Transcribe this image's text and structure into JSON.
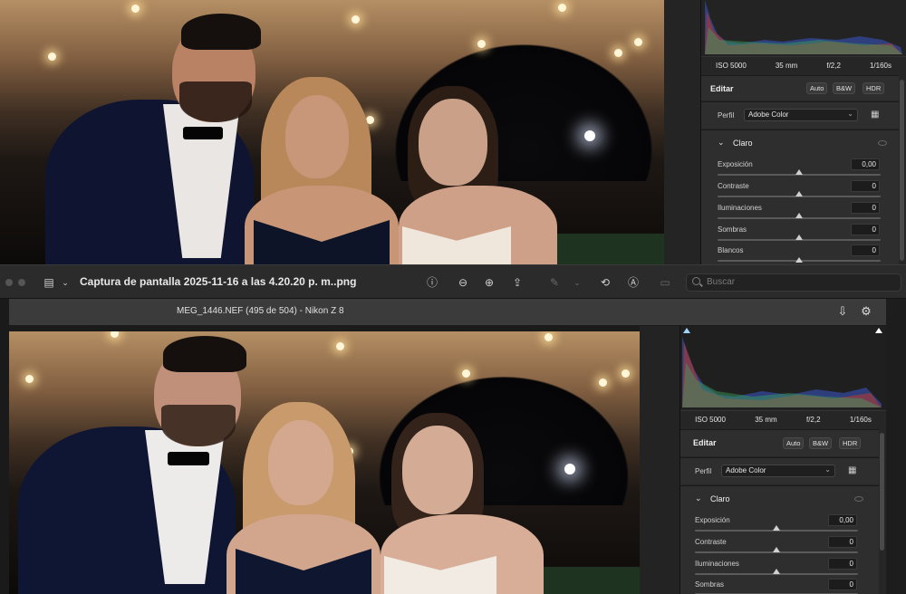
{
  "window": {
    "title": "Captura de pantalla 2025-11-16 a las 4.20.20 p. m..png",
    "search_placeholder": "Buscar"
  },
  "lightroom": {
    "file_info": "MEG_1446.NEF (495 de 504)  -  Nikon Z 8"
  },
  "editor": {
    "meta": {
      "iso": "ISO 5000",
      "focal": "35 mm",
      "aperture": "f/2,2",
      "shutter": "1/160s"
    },
    "edit_label": "Editar",
    "auto_label": "Auto",
    "bw_label": "B&W",
    "hdr_label": "HDR",
    "profile_label": "Perfil",
    "profile_value": "Adobe Color",
    "section_light": "Claro",
    "sliders_top": [
      {
        "label": "Exposición",
        "value": "0,00"
      },
      {
        "label": "Contraste",
        "value": "0"
      },
      {
        "label": "Iluminaciones",
        "value": "0"
      },
      {
        "label": "Sombras",
        "value": "0"
      },
      {
        "label": "Blancos",
        "value": "0"
      }
    ],
    "sliders_bottom": [
      {
        "label": "Exposición",
        "value": "0,00"
      },
      {
        "label": "Contraste",
        "value": "0"
      },
      {
        "label": "Iluminaciones",
        "value": "0"
      },
      {
        "label": "Sombras",
        "value": "0"
      }
    ]
  },
  "colors": {
    "panel_bg": "#262626",
    "toolbar_bg": "#2b2b2b",
    "lr_header_bg": "#3b3b3b",
    "hist_red": "#c0392b",
    "hist_green": "#3aa35a",
    "hist_blue": "#3b57c8"
  }
}
